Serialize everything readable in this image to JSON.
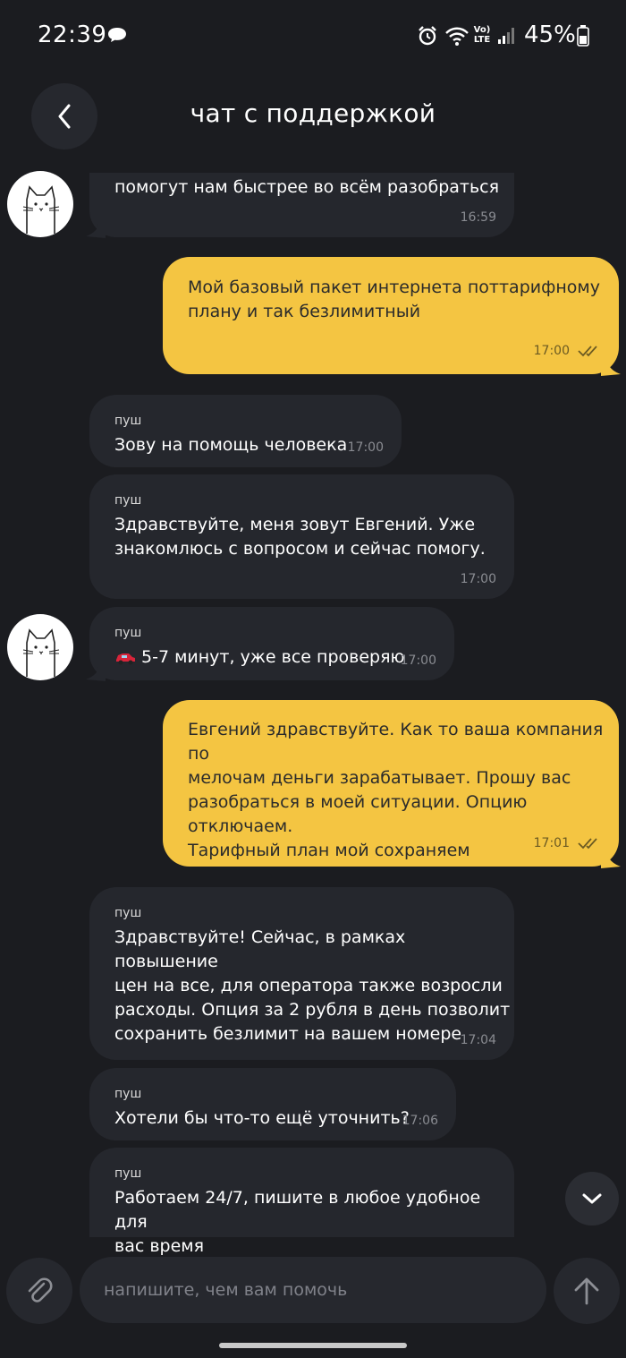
{
  "status_bar": {
    "time": "22:39",
    "network_label": "Vo) LTE",
    "battery_percent": "45%"
  },
  "header": {
    "title": "чат с поддержкой"
  },
  "messages": [
    {
      "direction": "in",
      "sender": "",
      "text": "помогут нам быстрее во всём разобраться",
      "time": "16:59",
      "avatar": true
    },
    {
      "direction": "out",
      "text": "Мой базовый пакет интернета поттарифному\nплану и так безлимитный",
      "time": "17:00",
      "read": true
    },
    {
      "direction": "in",
      "sender": "пуш",
      "text": "Зову на помощь человека",
      "time": "17:00"
    },
    {
      "direction": "in",
      "sender": "пуш",
      "text": "Здравствуйте, меня зовут Евгений. Уже\nзнакомлюсь с вопросом и сейчас помогу.",
      "time": "17:00"
    },
    {
      "direction": "in",
      "sender": "пуш",
      "text": "5-7 минут, уже все проверяю",
      "time": "17:00",
      "emoji": "car-icon",
      "avatar": true
    },
    {
      "direction": "out",
      "text": "Евгений здравствуйте. Как то ваша компания по\nмелочам деньги зарабатывает. Прошу вас\nразобраться в моей ситуации. Опцию отключаем.\nТарифный план мой сохраняем",
      "time": "17:01",
      "read": true
    },
    {
      "direction": "in",
      "sender": "пуш",
      "text": "Здравствуйте! Сейчас, в рамках повышение\nцен на все, для оператора также возросли\nрасходы. Опция за 2 рубля в день позволит\nсохранить безлимит на вашем номере",
      "time": "17:04"
    },
    {
      "direction": "in",
      "sender": "пуш",
      "text": "Хотели бы что-то ещё уточнить?",
      "time": "17:06"
    },
    {
      "direction": "in",
      "sender": "пуш",
      "text": "Работаем 24/7, пишите в любое удобное для\nвас время",
      "time": ""
    }
  ],
  "composer": {
    "placeholder": "напишите, чем вам помочь"
  },
  "icons": [
    "chat-bubble-icon",
    "alarm-icon",
    "wifi-icon",
    "signal-icon",
    "battery-icon",
    "chevron-left-icon",
    "cat-avatar-icon",
    "double-check-icon",
    "car-icon",
    "chevron-down-icon",
    "paperclip-icon",
    "arrow-up-icon"
  ],
  "colors": {
    "background": "#1b1c20",
    "incoming_bubble": "#25272d",
    "outgoing_bubble": "#f4c542"
  }
}
